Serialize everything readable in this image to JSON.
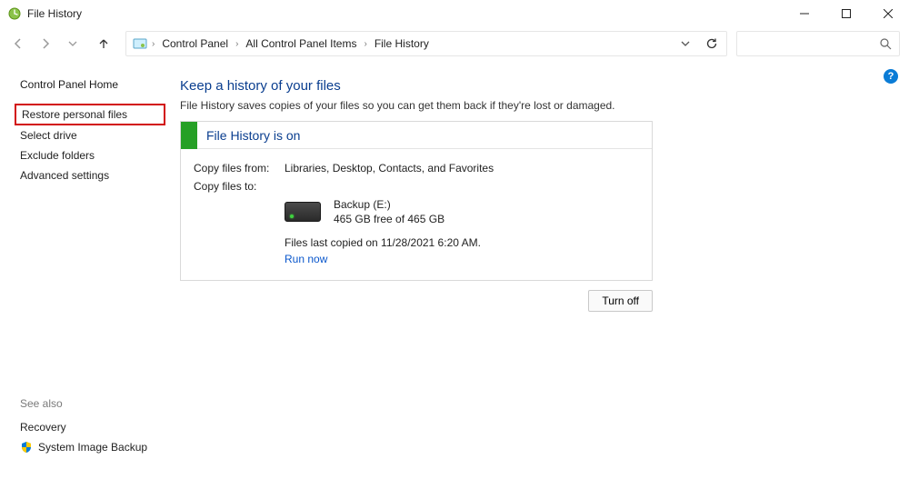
{
  "window": {
    "title": "File History"
  },
  "breadcrumb": {
    "cp": "Control Panel",
    "all": "All Control Panel Items",
    "fh": "File History"
  },
  "sidebar": {
    "home": "Control Panel Home",
    "items": [
      {
        "label": "Restore personal files",
        "highlight": true
      },
      {
        "label": "Select drive"
      },
      {
        "label": "Exclude folders"
      },
      {
        "label": "Advanced settings"
      }
    ]
  },
  "see_also": {
    "heading": "See also",
    "recovery": "Recovery",
    "system_image": "System Image Backup"
  },
  "main": {
    "heading": "Keep a history of your files",
    "subtitle": "File History saves copies of your files so you can get them back if they're lost or damaged.",
    "status": "File History is on",
    "copy_from_label": "Copy files from:",
    "copy_from_value": "Libraries, Desktop, Contacts, and Favorites",
    "copy_to_label": "Copy files to:",
    "drive_name": "Backup (E:)",
    "drive_free": "465 GB free of 465 GB",
    "last_copied": "Files last copied on 11/28/2021 6:20 AM.",
    "run_now": "Run now",
    "turn_off": "Turn off"
  },
  "help": "?"
}
